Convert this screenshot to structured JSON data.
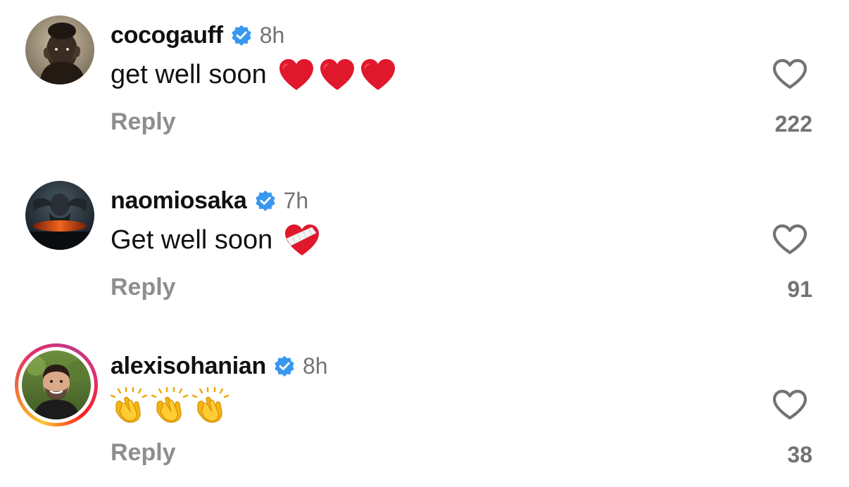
{
  "accent": {
    "verified": "#3897f0",
    "heart_emoji": "#e0182b",
    "muted": "#737373"
  },
  "comments": [
    {
      "username": "cocogauff",
      "verified": true,
      "time": "8h",
      "text": "get well soon",
      "emojis": [
        "red-heart",
        "red-heart",
        "red-heart"
      ],
      "reply_label": "Reply",
      "likes": "222",
      "story_ring": false
    },
    {
      "username": "naomiosaka",
      "verified": true,
      "time": "7h",
      "text": "Get well soon",
      "emojis": [
        "mending-heart"
      ],
      "reply_label": "Reply",
      "likes": "91",
      "story_ring": false
    },
    {
      "username": "alexisohanian",
      "verified": true,
      "time": "8h",
      "text": "",
      "emojis": [
        "clapping-hands",
        "clapping-hands",
        "clapping-hands"
      ],
      "reply_label": "Reply",
      "likes": "38",
      "story_ring": true
    }
  ]
}
